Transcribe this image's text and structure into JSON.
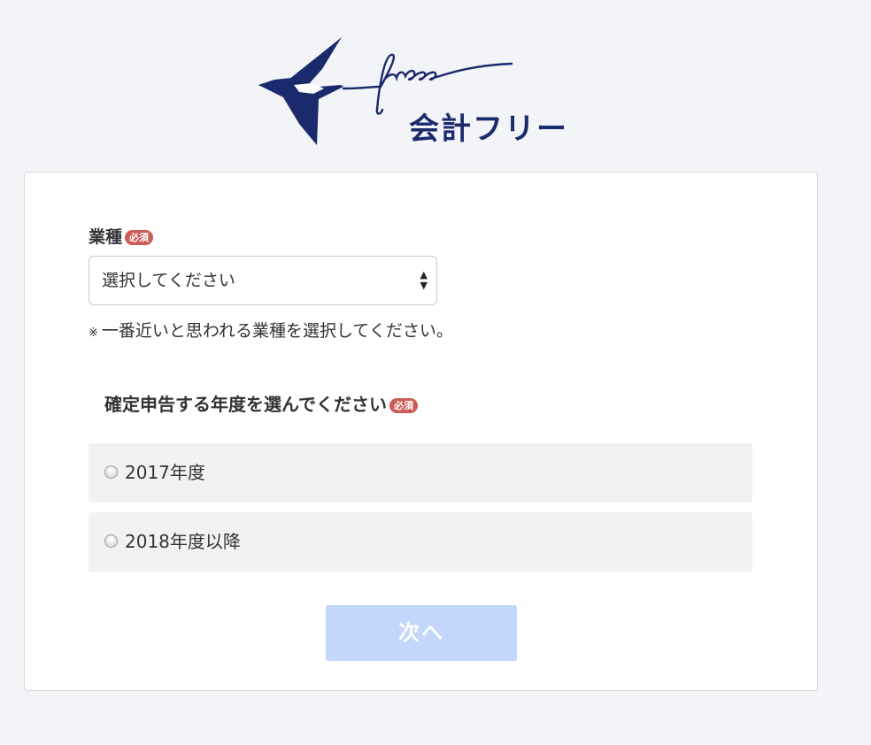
{
  "brand": {
    "script_text": "freee",
    "product_name": "会計フリー",
    "color": "#1a2a6c"
  },
  "form": {
    "industry": {
      "label": "業種",
      "required_badge": "必須",
      "select_value": "選択してください",
      "note_mark": "※",
      "note": "一番近いと思われる業種を選択してください。"
    },
    "year": {
      "label": "確定申告する年度を選んでください",
      "required_badge": "必須",
      "options": [
        {
          "label": "2017年度",
          "selected": false
        },
        {
          "label": "2018年度以降",
          "selected": false
        }
      ]
    },
    "next_button": "次へ"
  },
  "colors": {
    "badge": "#cc5a55",
    "button_disabled": "#c3d6fb",
    "background": "#f3f4f8"
  }
}
